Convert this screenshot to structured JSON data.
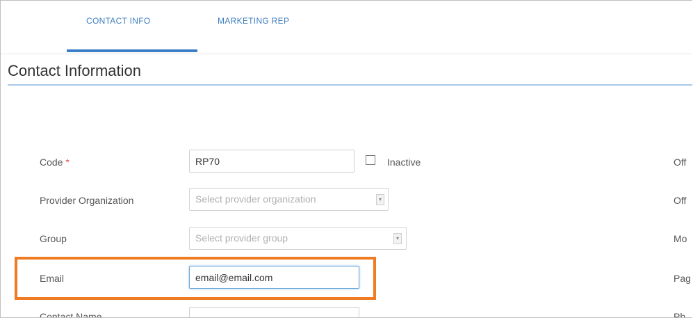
{
  "tabs": [
    {
      "label": "CONTACT INFO",
      "active": true
    },
    {
      "label": "MARKETING REP",
      "active": false
    }
  ],
  "section": {
    "title": "Contact Information"
  },
  "form": {
    "code": {
      "label": "Code",
      "required_mark": "*",
      "value": "RP70"
    },
    "inactive": {
      "label": "Inactive",
      "checked": false
    },
    "provider_org": {
      "label": "Provider Organization",
      "placeholder": "Select provider organization"
    },
    "group": {
      "label": "Group",
      "placeholder": "Select provider group"
    },
    "email": {
      "label": "Email",
      "value": "email@email.com"
    },
    "contact_name": {
      "label": "Contact Name",
      "value": ""
    }
  },
  "right_column": [
    "Off",
    "Off",
    "Mo",
    "Pag",
    "Ph"
  ],
  "colors": {
    "accent": "#3b7fc4",
    "highlight": "#ef7b22"
  },
  "icons": {
    "select_arrow": "chevron-down-icon"
  }
}
